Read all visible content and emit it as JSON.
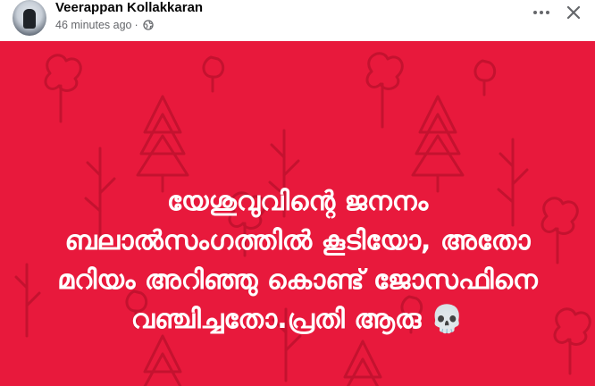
{
  "post": {
    "author": "Veerappan Kollakkaran",
    "time": "46 minutes ago",
    "separator": "·",
    "privacy_icon": "globe-icon",
    "actions": {
      "more_icon": "more-horizontal-icon",
      "close_icon": "close-icon"
    }
  },
  "card": {
    "background": "#e8193c",
    "pattern_color": "#c4122f",
    "text_color": "#ffffff",
    "lines": [
      "യേശുവുവിന്റെ ജനനം",
      "ബലാൽസംഗത്തിൽ കൂടിയോ, അതോ",
      "മറിയം അറിഞ്ഞു കൊണ്ട് ജോസഫിനെ",
      "വഞ്ചിച്ചതോ.പ്രതി ആരു 💀"
    ]
  }
}
